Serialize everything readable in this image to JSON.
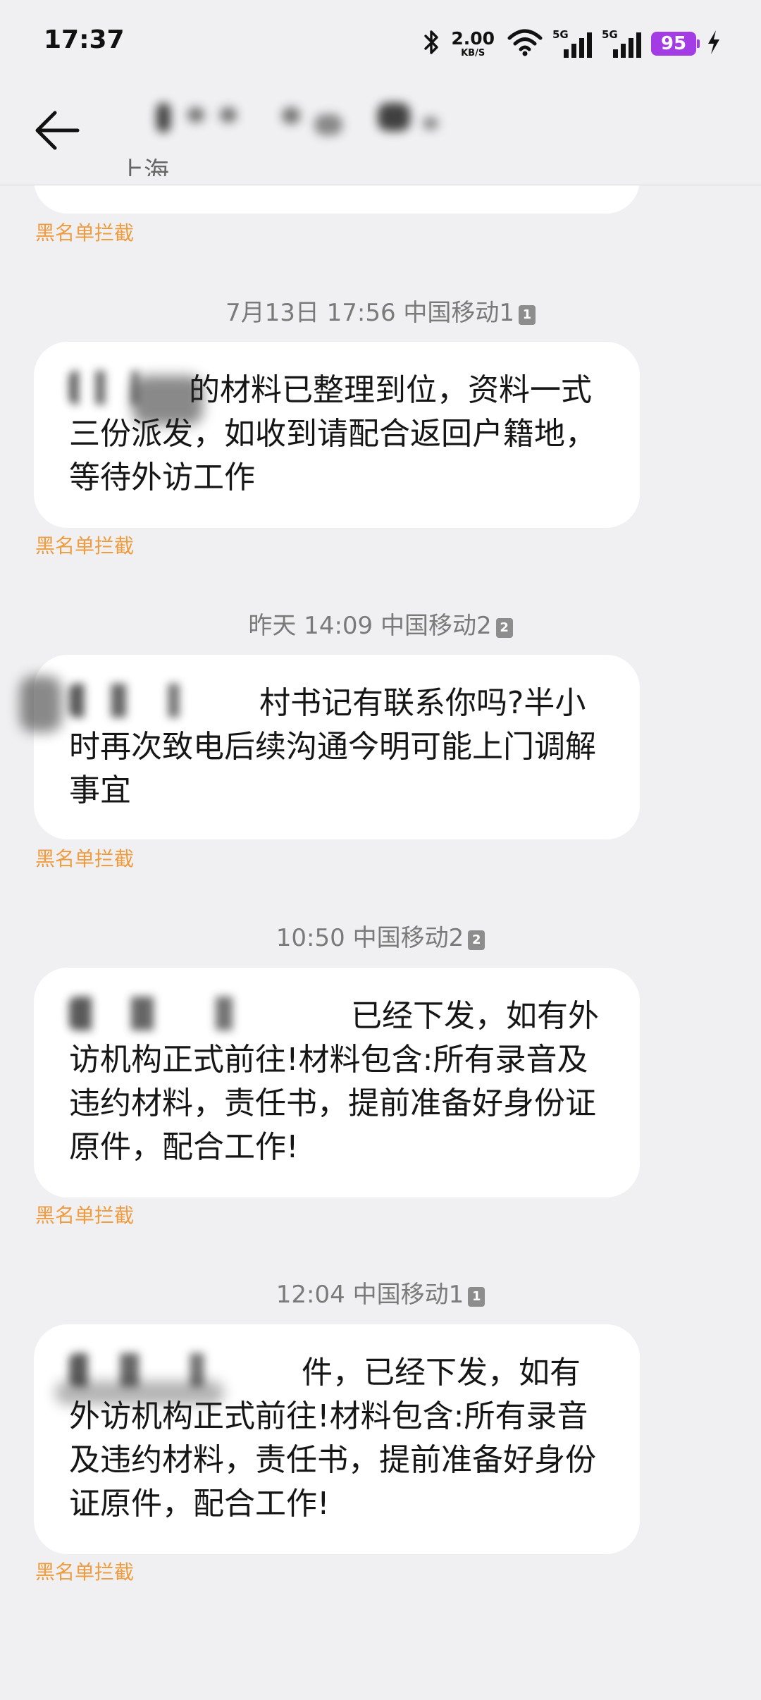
{
  "status_bar": {
    "time": "17:37",
    "net_speed_value": "2.00",
    "net_speed_unit": "KB/S",
    "sim1_label": "5G",
    "sim2_label": "5G",
    "battery_level": "95",
    "icons": [
      "bluetooth-icon",
      "wifi-icon",
      "signal-icon",
      "signal-icon",
      "battery-icon",
      "charging-icon"
    ],
    "battery_color": "#a43ce6"
  },
  "header": {
    "back_icon": "arrow-left-icon",
    "contact_location": "上海"
  },
  "block_tag_color": "#ef9b3e",
  "messages": [
    {
      "meta": "7月13日 17:56 中国移动1",
      "sim": "1",
      "text": "的材料已整理到位，资料一式三份派发，如收到请配合返回户籍地，等待外访工作",
      "block_tag": "黑名单拦截"
    },
    {
      "meta": "昨天 14:09 中国移动2",
      "sim": "2",
      "text": "村书记有联系你吗?半小时再次致电后续沟通今明可能上门调解事宜",
      "block_tag": "黑名单拦截"
    },
    {
      "meta": "10:50 中国移动2",
      "sim": "2",
      "text": "已经下发，如有外访机构正式前往!材料包含:所有录音及违约材料，责任书，提前准备好身份证原件，配合工作!",
      "block_tag": "黑名单拦截"
    },
    {
      "meta": "12:04 中国移动1",
      "sim": "1",
      "text": "件，已经下发，如有外访机构正式前往!材料包含:所有录音及违约材料，责任书，提前准备好身份证原件，配合工作!",
      "block_tag": "黑名单拦截"
    }
  ],
  "top_block_tag": "黑名单拦截"
}
